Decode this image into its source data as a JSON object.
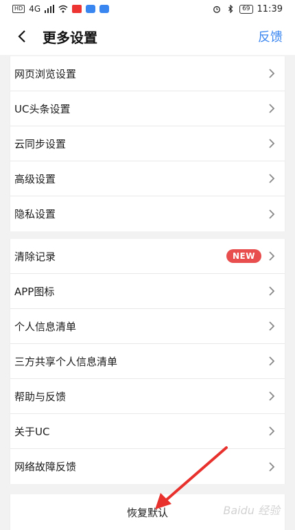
{
  "status_bar": {
    "time": "11:39",
    "battery": "69",
    "signal_label": "4G"
  },
  "header": {
    "title": "更多设置",
    "feedback_label": "反馈"
  },
  "group1": {
    "items": [
      {
        "label": "网页浏览设置"
      },
      {
        "label": "UC头条设置"
      },
      {
        "label": "云同步设置"
      },
      {
        "label": "高级设置"
      },
      {
        "label": "隐私设置"
      }
    ]
  },
  "group2": {
    "items": [
      {
        "label": "清除记录",
        "badge": "NEW"
      },
      {
        "label": "APP图标"
      },
      {
        "label": "个人信息清单"
      },
      {
        "label": "三方共享个人信息清单"
      },
      {
        "label": "帮助与反馈"
      },
      {
        "label": "关于UC"
      },
      {
        "label": "网络故障反馈"
      }
    ]
  },
  "restore_label": "恢复默认",
  "watermark": "Baidu 经验",
  "colors": {
    "accent": "#3a86f0",
    "badge": "#e84e4e",
    "arrow": "#e8312c"
  }
}
